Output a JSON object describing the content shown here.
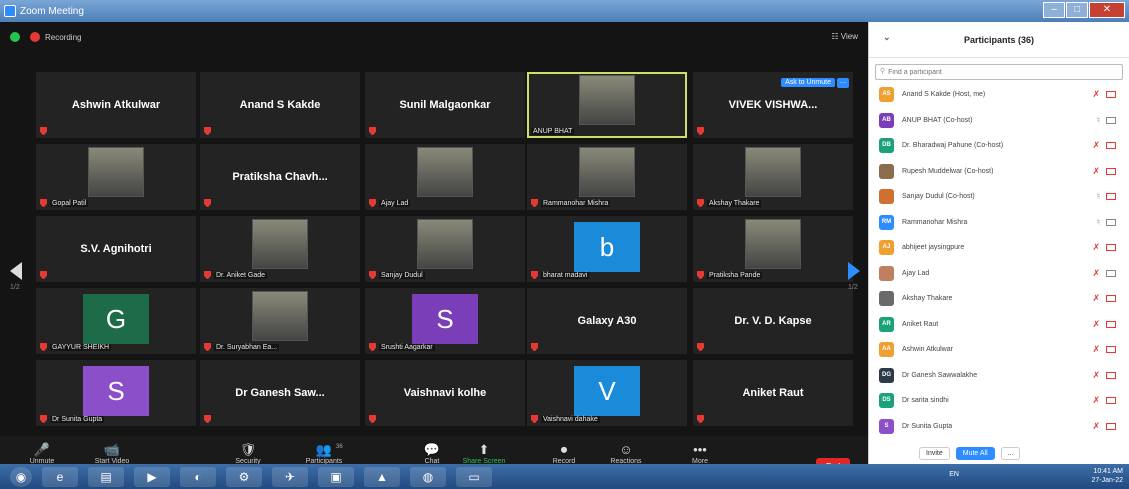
{
  "window": {
    "title": "Zoom Meeting"
  },
  "topbar": {
    "recording_label": "Recording",
    "view_label": "View"
  },
  "tiles": [
    {
      "name": "Ashwin Atkulwar",
      "kind": "name"
    },
    {
      "name": "Anand S Kakde",
      "kind": "name"
    },
    {
      "name": "Sunil Malgaonkar",
      "kind": "name"
    },
    {
      "name": "",
      "label": "ANUP BHAT",
      "kind": "photo",
      "active": true
    },
    {
      "name": "VIVEK VISHWA...",
      "kind": "name",
      "ask": "Ask to Unmute"
    },
    {
      "label": "Gopal Patil",
      "kind": "photo"
    },
    {
      "name": "Pratiksha Chavh...",
      "kind": "name"
    },
    {
      "label": "Ajay Lad",
      "kind": "photo"
    },
    {
      "label": "Rammanohar Mishra",
      "kind": "photo"
    },
    {
      "label": "Akshay Thakare",
      "kind": "photo"
    },
    {
      "name": "S.V. Agnihotri",
      "kind": "name"
    },
    {
      "label": "Dr. Aniket Gade",
      "kind": "photo"
    },
    {
      "label": "Sanjay Dudul",
      "kind": "photo"
    },
    {
      "label": "bharat madavi",
      "kind": "letter",
      "letter": "b",
      "color": "#1a8bd8"
    },
    {
      "label": "Pratiksha Pande",
      "kind": "photo"
    },
    {
      "label": "GAYYUR SHEIKH",
      "kind": "letter",
      "letter": "G",
      "color": "#1e6b4a"
    },
    {
      "label": "Dr. Suryabhan Ea...",
      "kind": "photo"
    },
    {
      "label": "Srushti Aagarkar",
      "kind": "letter",
      "letter": "S",
      "color": "#7a3fb8"
    },
    {
      "name": "Galaxy A30",
      "kind": "name"
    },
    {
      "name": "Dr. V. D. Kapse",
      "kind": "name"
    },
    {
      "label": "Dr Sunita Gupta",
      "kind": "letter",
      "letter": "S",
      "color": "#8b4fc9"
    },
    {
      "name": "Dr Ganesh Saw...",
      "kind": "name"
    },
    {
      "name": "Vaishnavi kolhe",
      "kind": "name"
    },
    {
      "label": "Vaishnavi dahake",
      "kind": "letter",
      "letter": "V",
      "color": "#1a8bd8"
    },
    {
      "name": "Aniket Raut",
      "kind": "name"
    }
  ],
  "pagination": {
    "left": "1/2",
    "right": "1/2"
  },
  "toolbar": [
    {
      "label": "Unmute",
      "icon": "mic-off-icon",
      "glyph": "🎤"
    },
    {
      "label": "Start Video",
      "icon": "video-off-icon",
      "glyph": "📹"
    },
    {
      "label": "Security",
      "icon": "shield-icon",
      "glyph": "🛡"
    },
    {
      "label": "Participants",
      "icon": "participants-icon",
      "glyph": "👥",
      "badge": "36"
    },
    {
      "label": "Chat",
      "icon": "chat-icon",
      "glyph": "💬"
    },
    {
      "label": "Share Screen",
      "icon": "share-screen-icon",
      "glyph": "⬆"
    },
    {
      "label": "Record",
      "icon": "record-icon",
      "glyph": "⏺"
    },
    {
      "label": "Reactions",
      "icon": "reactions-icon",
      "glyph": "☺"
    },
    {
      "label": "More",
      "icon": "more-icon",
      "glyph": "•••"
    }
  ],
  "end_label": "End",
  "panel": {
    "title": "Participants (36)",
    "search_placeholder": "Find a participant",
    "participants": [
      {
        "initials": "AS",
        "name": "Anand S Kakde (Host, me)",
        "color": "#f0a030",
        "mic": "off",
        "cam": "off"
      },
      {
        "initials": "AB",
        "name": "ANUP BHAT (Co-host)",
        "color": "#7a3fb8",
        "mic": "on",
        "cam": "on"
      },
      {
        "initials": "DB",
        "name": "Dr. Bharadwaj Pahune (Co-host)",
        "color": "#1aa37a",
        "mic": "off",
        "cam": "off"
      },
      {
        "initials": "",
        "name": "Rupesh Muddelwar (Co-host)",
        "color": "#8a6d4a",
        "mic": "off",
        "cam": "off"
      },
      {
        "initials": "",
        "name": "Sanjay Dudul (Co-host)",
        "color": "#d07030",
        "mic": "on",
        "cam": "off"
      },
      {
        "initials": "RM",
        "name": "Rammanohar Mishra",
        "color": "#2d8cff",
        "mic": "on",
        "cam": "on"
      },
      {
        "initials": "AJ",
        "name": "abhijeet jaysingpure",
        "color": "#f0a030",
        "mic": "off",
        "cam": "off"
      },
      {
        "initials": "",
        "name": "Ajay Lad",
        "color": "#c08060",
        "mic": "off",
        "cam": "on"
      },
      {
        "initials": "",
        "name": "Akshay Thakare",
        "color": "#6a6a6a",
        "mic": "off",
        "cam": "off"
      },
      {
        "initials": "AR",
        "name": "Aniket Raut",
        "color": "#1aa37a",
        "mic": "off",
        "cam": "off"
      },
      {
        "initials": "AA",
        "name": "Ashwin Atkulwar",
        "color": "#f0a030",
        "mic": "off",
        "cam": "off"
      },
      {
        "initials": "DG",
        "name": "Dr Ganesh Sawwalakhe",
        "color": "#2a3a4a",
        "mic": "off",
        "cam": "off"
      },
      {
        "initials": "DS",
        "name": "Dr sarita sindhi",
        "color": "#1aa37a",
        "mic": "off",
        "cam": "off"
      },
      {
        "initials": "S",
        "name": "Dr Sunita Gupta",
        "color": "#8b4fc9",
        "mic": "off",
        "cam": "off"
      }
    ],
    "invite_label": "Invite",
    "mute_all_label": "Mute All",
    "more_label": "..."
  },
  "taskbar": {
    "lang": "EN",
    "time": "10:41 AM",
    "date": "27-Jan-22"
  }
}
